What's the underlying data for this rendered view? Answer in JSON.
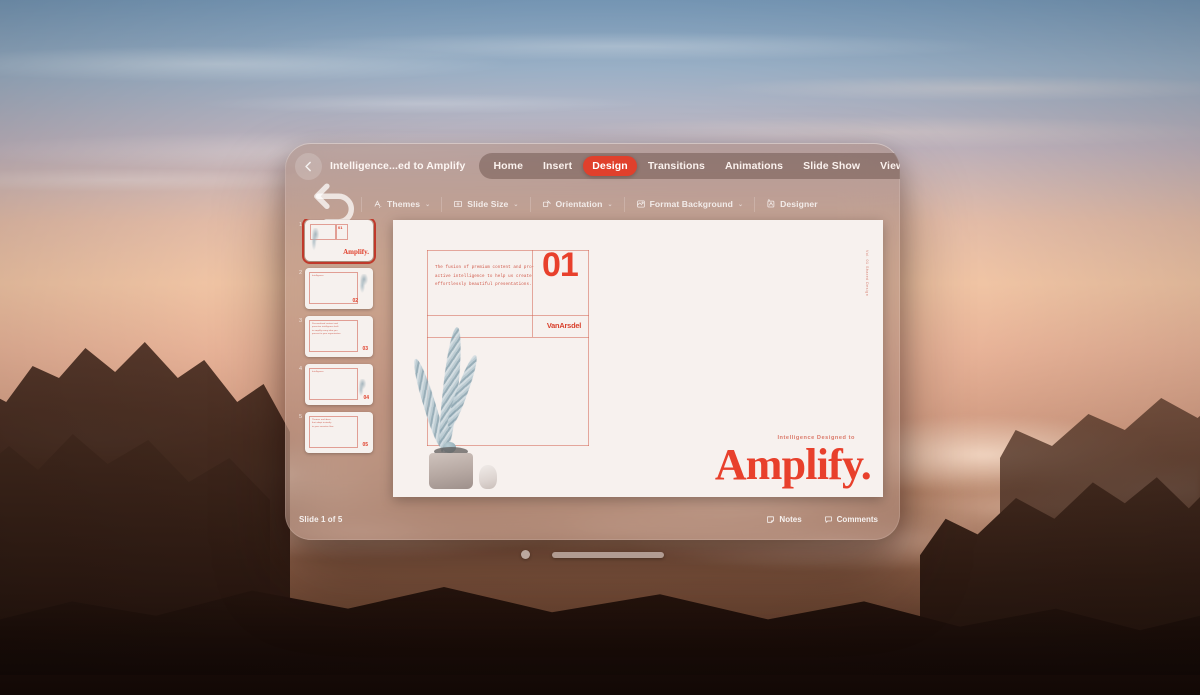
{
  "app": {
    "document_title": "Intelligence...ed to Amplify",
    "back_icon": "chevron-left-icon"
  },
  "tabs": [
    {
      "label": "Home",
      "active": false
    },
    {
      "label": "Insert",
      "active": false
    },
    {
      "label": "Design",
      "active": true
    },
    {
      "label": "Transitions",
      "active": false
    },
    {
      "label": "Animations",
      "active": false
    },
    {
      "label": "Slide Show",
      "active": false
    },
    {
      "label": "View",
      "active": false
    }
  ],
  "title_actions": [
    {
      "name": "present-button",
      "icon": "play-icon"
    },
    {
      "name": "search-button",
      "icon": "search-icon"
    },
    {
      "name": "share-button",
      "icon": "share-icon"
    },
    {
      "name": "more-button",
      "icon": "ellipsis-icon"
    }
  ],
  "ribbon": {
    "undo_icon": "undo-icon",
    "items": [
      {
        "label": "Themes",
        "icon": "themes-icon",
        "caret": "⌄"
      },
      {
        "label": "Slide Size",
        "icon": "slide-size-icon",
        "caret": "⌄"
      },
      {
        "label": "Orientation",
        "icon": "orientation-icon",
        "caret": "⌄"
      },
      {
        "label": "Format Background",
        "icon": "format-background-icon",
        "caret": "⌄"
      },
      {
        "label": "Designer",
        "icon": "designer-icon",
        "caret": ""
      }
    ]
  },
  "thumbnails": [
    {
      "number": "1",
      "badge": "01",
      "selected": true
    },
    {
      "number": "2",
      "badge": "02",
      "selected": false
    },
    {
      "number": "3",
      "badge": "03",
      "selected": false
    },
    {
      "number": "4",
      "badge": "04",
      "selected": false
    },
    {
      "number": "5",
      "badge": "05",
      "selected": false
    }
  ],
  "thumb_mini": {
    "amplify": "Amplify.",
    "lorem": "Intelligence",
    "lorem_long": "Personalized content and\nproactive intelligence built\nto amplify every idea you\npresent to your organization",
    "lorem_short": "Themes and ideas\nthat adapt instantly\nto your narrative flow"
  },
  "slide": {
    "body_text": "The fusion of premium content and pro-active intelligence to help us create effortlessly beautiful presentations.",
    "number": "01",
    "brand": "VanArsdel",
    "vertical_text": "Vol. 01  Shared Design",
    "kicker": "Intelligence Designed to",
    "headline": "Amplify."
  },
  "statusbar": {
    "slide_counter": "Slide 1 of 5",
    "notes_label": "Notes",
    "comments_label": "Comments",
    "notes_icon": "notes-icon",
    "comments_icon": "comment-icon"
  },
  "window_controls": {
    "close_dot": "close-window-dot",
    "resize_bar": "window-resize-bar"
  },
  "colors": {
    "accent_red": "#e0402c",
    "slide_bg": "#f7f1ee",
    "glass": "rgba(156,126,116,.46)"
  }
}
